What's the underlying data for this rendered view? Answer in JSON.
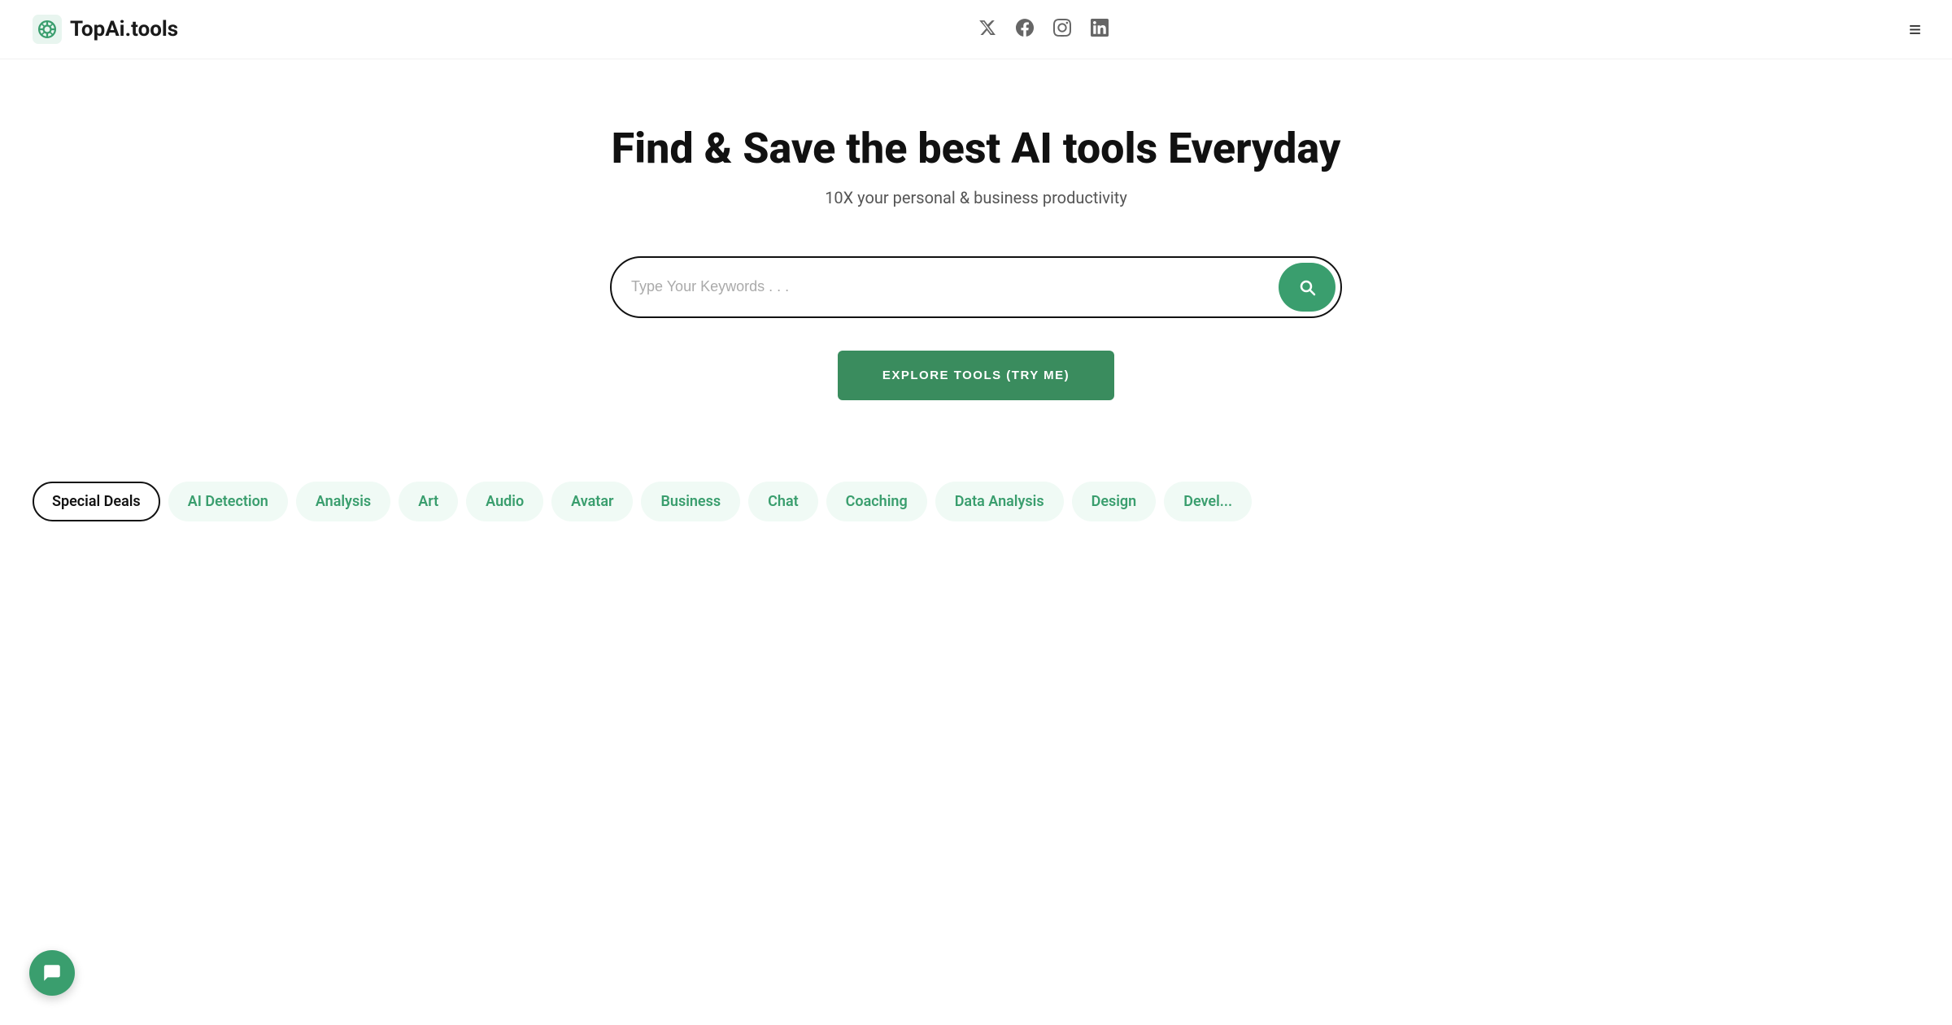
{
  "header": {
    "logo_text": "TopAi.tools",
    "social_icons": [
      {
        "name": "twitter-icon",
        "symbol": "𝕏"
      },
      {
        "name": "facebook-icon",
        "symbol": "f"
      },
      {
        "name": "instagram-icon",
        "symbol": "◎"
      },
      {
        "name": "linkedin-icon",
        "symbol": "in"
      }
    ],
    "menu_icon": "≡"
  },
  "hero": {
    "title": "Find & Save the best AI tools Everyday",
    "subtitle": "10X your personal & business productivity"
  },
  "search": {
    "placeholder": "Type Your Keywords . . ."
  },
  "explore_button": {
    "label": "EXPLORE TOOLS (TRY ME)"
  },
  "tags": [
    {
      "label": "Special Deals",
      "active": true
    },
    {
      "label": "AI Detection",
      "active": false
    },
    {
      "label": "Analysis",
      "active": false
    },
    {
      "label": "Art",
      "active": false
    },
    {
      "label": "Audio",
      "active": false
    },
    {
      "label": "Avatar",
      "active": false
    },
    {
      "label": "Business",
      "active": false
    },
    {
      "label": "Chat",
      "active": false
    },
    {
      "label": "Coaching",
      "active": false
    },
    {
      "label": "Data Analysis",
      "active": false
    },
    {
      "label": "Design",
      "active": false
    },
    {
      "label": "Devel...",
      "active": false
    }
  ],
  "colors": {
    "accent": "#3a9e6e",
    "accent_dark": "#2d7a50",
    "text_primary": "#111111",
    "text_secondary": "#555555"
  }
}
